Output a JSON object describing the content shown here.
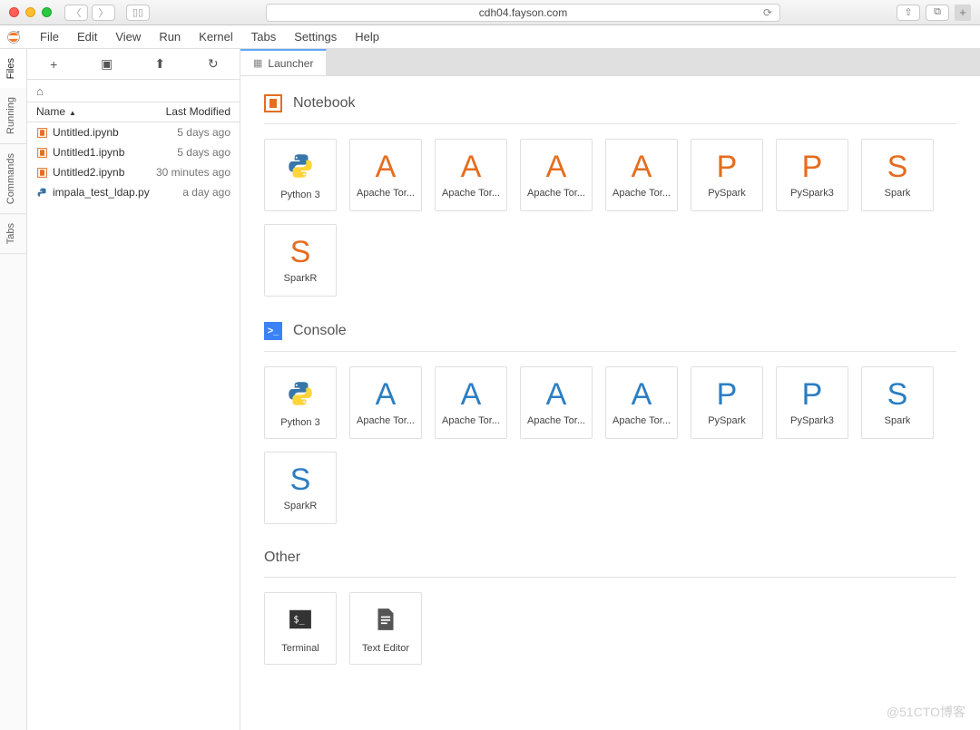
{
  "browser": {
    "url": "cdh04.fayson.com"
  },
  "menu": [
    "File",
    "Edit",
    "View",
    "Run",
    "Kernel",
    "Tabs",
    "Settings",
    "Help"
  ],
  "sidebar_tabs": [
    "Files",
    "Running",
    "Commands",
    "Tabs"
  ],
  "file_header": {
    "name": "Name",
    "mod": "Last Modified"
  },
  "files": [
    {
      "name": "Untitled.ipynb",
      "modified": "5 days ago",
      "icon": "notebook"
    },
    {
      "name": "Untitled1.ipynb",
      "modified": "5 days ago",
      "icon": "notebook"
    },
    {
      "name": "Untitled2.ipynb",
      "modified": "30 minutes ago",
      "icon": "notebook"
    },
    {
      "name": "impala_test_ldap.py",
      "modified": "a day ago",
      "icon": "python"
    }
  ],
  "tab_label": "Launcher",
  "sections": {
    "notebook": {
      "title": "Notebook",
      "cards": [
        {
          "glyph": "python",
          "label": "Python 3",
          "color": "blue"
        },
        {
          "glyph": "A",
          "label": "Apache Tor...",
          "color": "orange"
        },
        {
          "glyph": "A",
          "label": "Apache Tor...",
          "color": "orange"
        },
        {
          "glyph": "A",
          "label": "Apache Tor...",
          "color": "orange"
        },
        {
          "glyph": "A",
          "label": "Apache Tor...",
          "color": "orange"
        },
        {
          "glyph": "P",
          "label": "PySpark",
          "color": "orange"
        },
        {
          "glyph": "P",
          "label": "PySpark3",
          "color": "orange"
        },
        {
          "glyph": "S",
          "label": "Spark",
          "color": "orange"
        },
        {
          "glyph": "S",
          "label": "SparkR",
          "color": "orange"
        }
      ]
    },
    "console": {
      "title": "Console",
      "cards": [
        {
          "glyph": "python",
          "label": "Python 3",
          "color": "blue"
        },
        {
          "glyph": "A",
          "label": "Apache Tor...",
          "color": "blue"
        },
        {
          "glyph": "A",
          "label": "Apache Tor...",
          "color": "blue"
        },
        {
          "glyph": "A",
          "label": "Apache Tor...",
          "color": "blue"
        },
        {
          "glyph": "A",
          "label": "Apache Tor...",
          "color": "blue"
        },
        {
          "glyph": "P",
          "label": "PySpark",
          "color": "blue"
        },
        {
          "glyph": "P",
          "label": "PySpark3",
          "color": "blue"
        },
        {
          "glyph": "S",
          "label": "Spark",
          "color": "blue"
        },
        {
          "glyph": "S",
          "label": "SparkR",
          "color": "blue"
        }
      ]
    },
    "other": {
      "title": "Other",
      "cards": [
        {
          "glyph": "terminal",
          "label": "Terminal",
          "color": "dark"
        },
        {
          "glyph": "texteditor",
          "label": "Text Editor",
          "color": "dark"
        }
      ]
    }
  },
  "watermark": "@51CTO博客"
}
